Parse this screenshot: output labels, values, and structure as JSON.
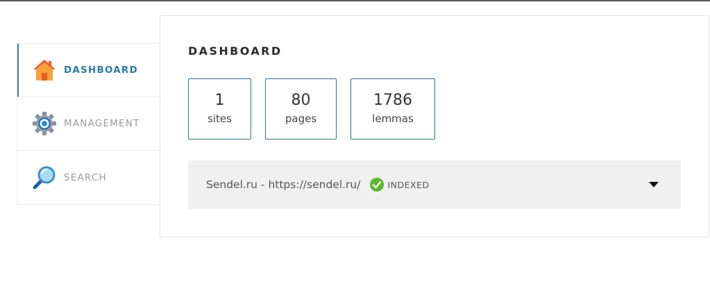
{
  "sidebar": {
    "items": [
      {
        "label": "DASHBOARD",
        "icon": "home-icon",
        "active": true
      },
      {
        "label": "MANAGEMENT",
        "icon": "gear-icon",
        "active": false
      },
      {
        "label": "SEARCH",
        "icon": "magnifier-icon",
        "active": false
      }
    ]
  },
  "main": {
    "title": "DASHBOARD",
    "stats": [
      {
        "value": "1",
        "label": "sites"
      },
      {
        "value": "80",
        "label": "pages"
      },
      {
        "value": "1786",
        "label": "lemmas"
      }
    ],
    "sites": [
      {
        "name": "Sendel.ru - https://sendel.ru/",
        "status": "INDEXED",
        "status_color": "#5cb82e"
      }
    ]
  },
  "colors": {
    "accent": "#2a7ab0",
    "stat_border": "#2a6f96",
    "row_background": "#f0f0f0"
  }
}
